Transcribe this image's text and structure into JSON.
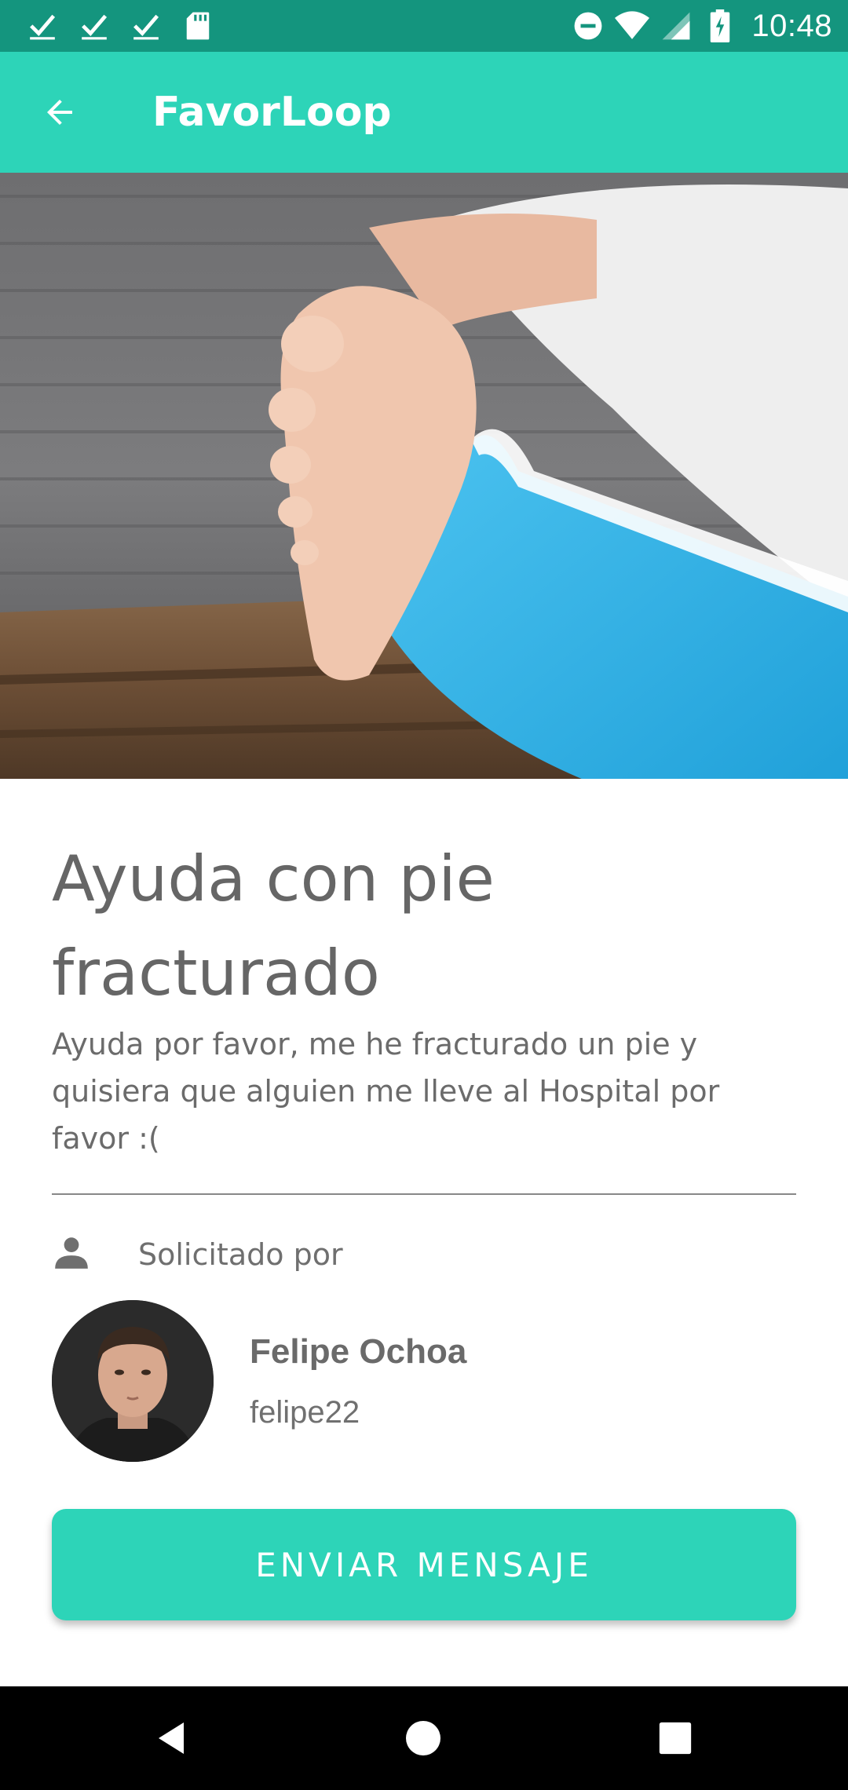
{
  "status_bar": {
    "time": "10:48",
    "left_icons": [
      "check-icon",
      "check-icon",
      "check-icon",
      "sd-card-icon"
    ],
    "right_icons": [
      "do-not-disturb-icon",
      "wifi-icon",
      "signal-icon",
      "battery-charging-icon"
    ]
  },
  "app_bar": {
    "title": "FavorLoop",
    "back_icon": "arrow-back-icon"
  },
  "hero": {
    "image": "foot-cast-photo"
  },
  "request": {
    "title_line1": "Ayuda con pie",
    "title_line2": "fracturado",
    "description": "Ayuda por favor, me he fracturado un pie y quisiera que alguien me lleve al Hospital por favor :("
  },
  "requester": {
    "label": "Solicitado por",
    "name": "Felipe Ochoa",
    "username": "felipe22"
  },
  "actions": {
    "send_message": "ENVIAR MENSAJE"
  },
  "colors": {
    "status_bar": "#14957e",
    "accent": "#2dd4b8",
    "text": "#666666"
  }
}
